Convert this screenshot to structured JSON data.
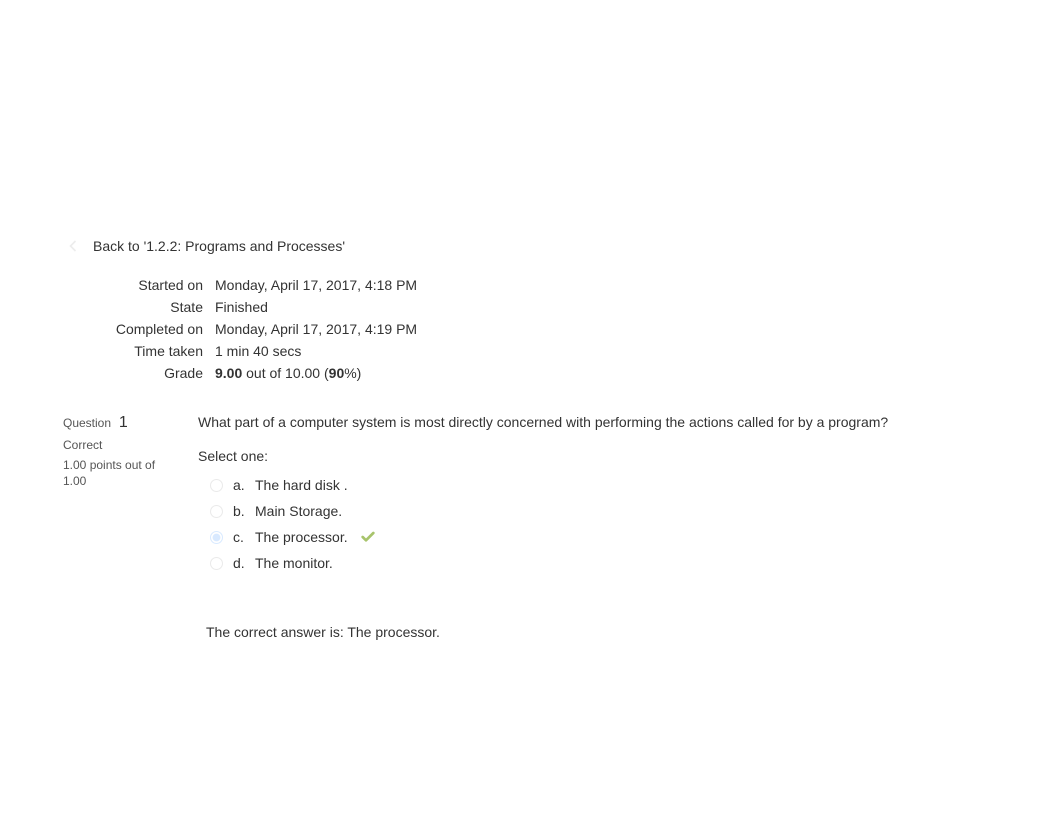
{
  "back_link": {
    "text": "Back to '1.2.2: Programs and Processes'"
  },
  "summary": {
    "started_on_label": "Started on",
    "started_on_value": "Monday, April 17, 2017, 4:18 PM",
    "state_label": "State",
    "state_value": "Finished",
    "completed_on_label": "Completed on",
    "completed_on_value": "Monday, April 17, 2017, 4:19 PM",
    "time_taken_label": "Time taken",
    "time_taken_value": "1 min 40 secs",
    "grade_label": "Grade",
    "grade_score": "9.00",
    "grade_out_of": " out of 10.00 (",
    "grade_percent": "90",
    "grade_percent_suffix": "%)"
  },
  "question": {
    "label": "Question",
    "number": "1",
    "status": "Correct",
    "points": "1.00 points out of 1.00",
    "text": "What part of a computer system is most directly concerned with performing the actions called for by a program?",
    "select_label": "Select one:",
    "options": [
      {
        "letter": "a.",
        "text": "The hard disk .",
        "selected": false,
        "correct": false
      },
      {
        "letter": "b.",
        "text": "Main Storage.",
        "selected": false,
        "correct": false
      },
      {
        "letter": "c.",
        "text": "The processor.",
        "selected": true,
        "correct": true
      },
      {
        "letter": "d.",
        "text": "The monitor.",
        "selected": false,
        "correct": false
      }
    ],
    "feedback": "The correct answer is: The processor."
  }
}
